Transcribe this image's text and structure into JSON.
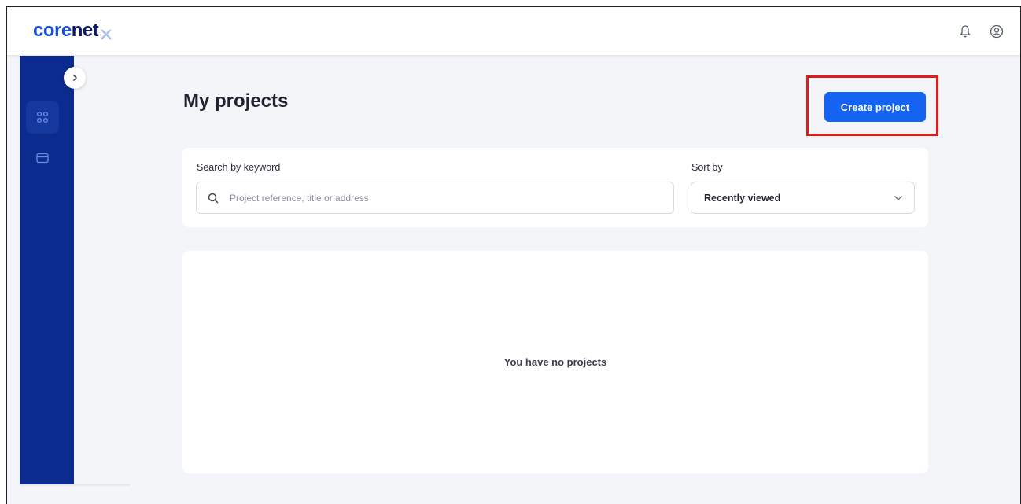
{
  "brand": {
    "logo_core": "core",
    "logo_net": "net",
    "primary_color": "#1463f3",
    "sidebar_color": "#0b2b8f",
    "highlight_color": "#e01b1b"
  },
  "header": {
    "icons": [
      "bell-icon",
      "user-circle-icon"
    ]
  },
  "sidebar": {
    "items": [
      {
        "icon": "grid-icon",
        "active": true
      },
      {
        "icon": "card-icon",
        "active": false
      }
    ],
    "toggle_icon": "chevron-right-icon"
  },
  "page": {
    "title": "My projects",
    "create_button": "Create project",
    "search": {
      "label": "Search by keyword",
      "placeholder": "Project reference, title or address",
      "value": ""
    },
    "sort": {
      "label": "Sort by",
      "value": "Recently viewed"
    },
    "empty_message": "You have no projects"
  }
}
